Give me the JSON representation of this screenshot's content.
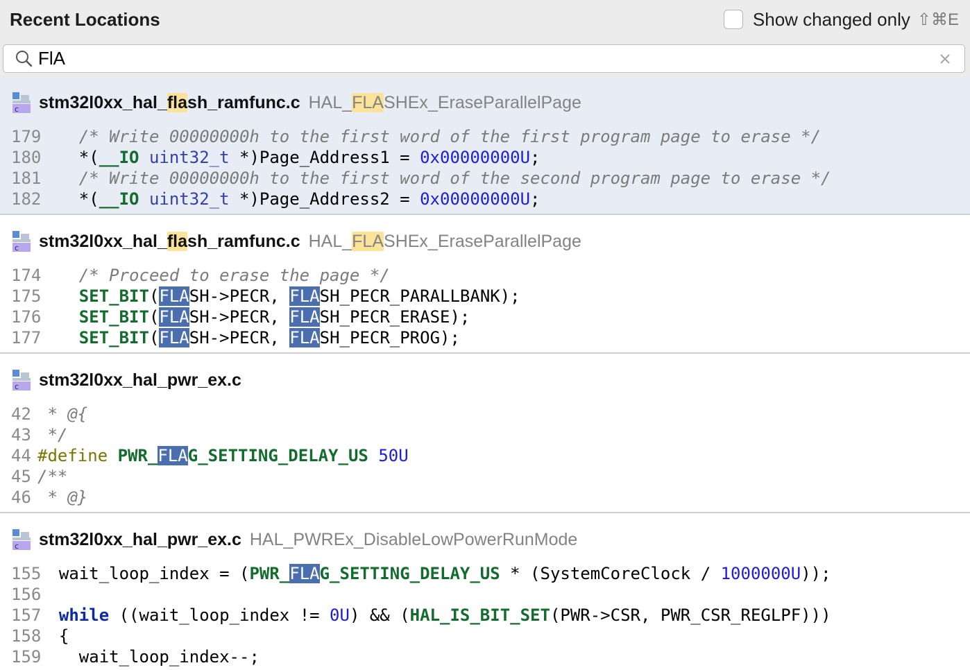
{
  "header": {
    "title": "Recent Locations",
    "show_changed_label": "Show changed only",
    "shortcut": "⇧⌘E"
  },
  "search": {
    "value": "FlA"
  },
  "icons": {
    "file": "c-file-icon",
    "search": "search-icon",
    "clear": "close-icon"
  },
  "colors": {
    "selected_bg": "#e8edf5",
    "match_yellow": "#fbe39a",
    "match_blue": "#4b6eaf"
  },
  "groups": [
    {
      "file_pre": "stm32l0xx_hal_",
      "file_hl": "fla",
      "file_post": "sh_ramfunc.c",
      "func_pre": "HAL_",
      "func_hl": "FLA",
      "func_post": "SHEx_EraseParallelPage",
      "lines": [
        "179",
        "180",
        "181",
        "182"
      ],
      "code": {
        "l1": "/* Write 00000000h to the first word of the first program page to erase */",
        "l2_a": "*(",
        "l2_b": "__IO",
        "l2_c": " ",
        "l2_d": "uint32_t",
        "l2_e": " *)Page_Address1 = ",
        "l2_f": "0x00000000U",
        "l2_g": ";",
        "l3": "/* Write 00000000h to the first word of the second program page to erase */",
        "l4_a": "*(",
        "l4_b": "__IO",
        "l4_c": " ",
        "l4_d": "uint32_t",
        "l4_e": " *)Page_Address2 = ",
        "l4_f": "0x00000000U",
        "l4_g": ";"
      }
    },
    {
      "file_pre": "stm32l0xx_hal_",
      "file_hl": "fla",
      "file_post": "sh_ramfunc.c",
      "func_pre": "HAL_",
      "func_hl": "FLA",
      "func_post": "SHEx_EraseParallelPage",
      "lines": [
        "174",
        "175",
        "176",
        "177"
      ],
      "code": {
        "l1": "/* Proceed to erase the page */",
        "macro": "SET_BIT",
        "open": "(",
        "hl": "FLA",
        "l2_mid": "SH->PECR, ",
        "l2_end": "SH_PECR_PARALLBANK);",
        "l3_end": "SH_PECR_ERASE);",
        "l4_end": "SH_PECR_PROG);"
      }
    },
    {
      "file": "stm32l0xx_hal_pwr_ex.c",
      "lines": [
        "42",
        "43",
        "44",
        "45",
        "46"
      ],
      "code": {
        "l1": " * @{",
        "l2": " */",
        "l3_pp": "#define",
        "l3_pre": "PWR_",
        "l3_hl": "FLA",
        "l3_post": "G_SETTING_DELAY_US",
        "l3_num": "50U",
        "l4": "/**",
        "l5": " * @}"
      }
    },
    {
      "file": "stm32l0xx_hal_pwr_ex.c",
      "func": "HAL_PWREx_DisableLowPowerRunMode",
      "lines": [
        "155",
        "156",
        "157",
        "158",
        "159"
      ],
      "code": {
        "l1_a": "wait_loop_index = (",
        "l1_b": "PWR_",
        "l1_hl": "FLA",
        "l1_c": "G_SETTING_DELAY_US",
        "l1_d": " * (SystemCoreClock / ",
        "l1_num": "1000000U",
        "l1_e": "));",
        "l3_kw": "while",
        "l3_a": " ((wait_loop_index != ",
        "l3_num": "0U",
        "l3_b": ") && (",
        "l3_macro": "HAL_IS_BIT_SET",
        "l3_c": "(PWR->CSR, PWR_CSR_REGLPF)))",
        "l4": "{",
        "l5": "  wait_loop_index--;"
      }
    }
  ]
}
